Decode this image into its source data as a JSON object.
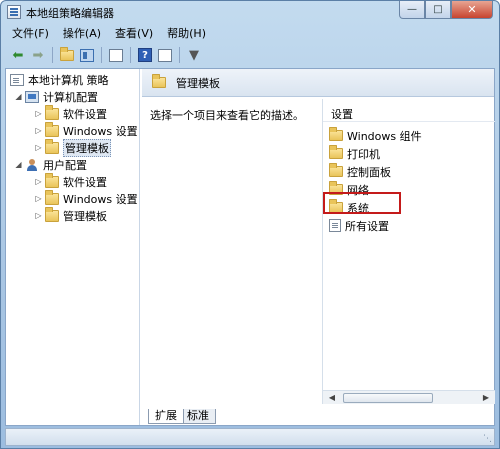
{
  "window": {
    "title": "本地组策略编辑器"
  },
  "menubar": {
    "items": [
      "文件(F)",
      "操作(A)",
      "查看(V)",
      "帮助(H)"
    ]
  },
  "toolbar": {
    "icons": [
      "back-arrow-icon",
      "forward-arrow-icon",
      "up-folder-icon",
      "show-hide-tree-icon",
      "export-list-icon",
      "help-icon",
      "show-hide-action-pane-icon",
      "filter-icon"
    ]
  },
  "tree": {
    "root": "本地计算机 策略",
    "computer_config": "计算机配置",
    "computer_children": [
      "软件设置",
      "Windows 设置",
      "管理模板"
    ],
    "user_config": "用户配置",
    "user_children": [
      "软件设置",
      "Windows 设置",
      "管理模板"
    ]
  },
  "right_pane": {
    "header_title": "管理模板",
    "description": "选择一个项目来查看它的描述。",
    "list_header": "设置",
    "items": [
      "Windows 组件",
      "打印机",
      "控制面板",
      "网络",
      "系统",
      "所有设置"
    ],
    "highlighted_item": "系统"
  },
  "tabs": [
    "扩展",
    "标准"
  ],
  "colors": {
    "highlight_border": "#c41a1a",
    "selection_bg": "#dfe8f3",
    "folder_yellow": "#e9c45a"
  }
}
